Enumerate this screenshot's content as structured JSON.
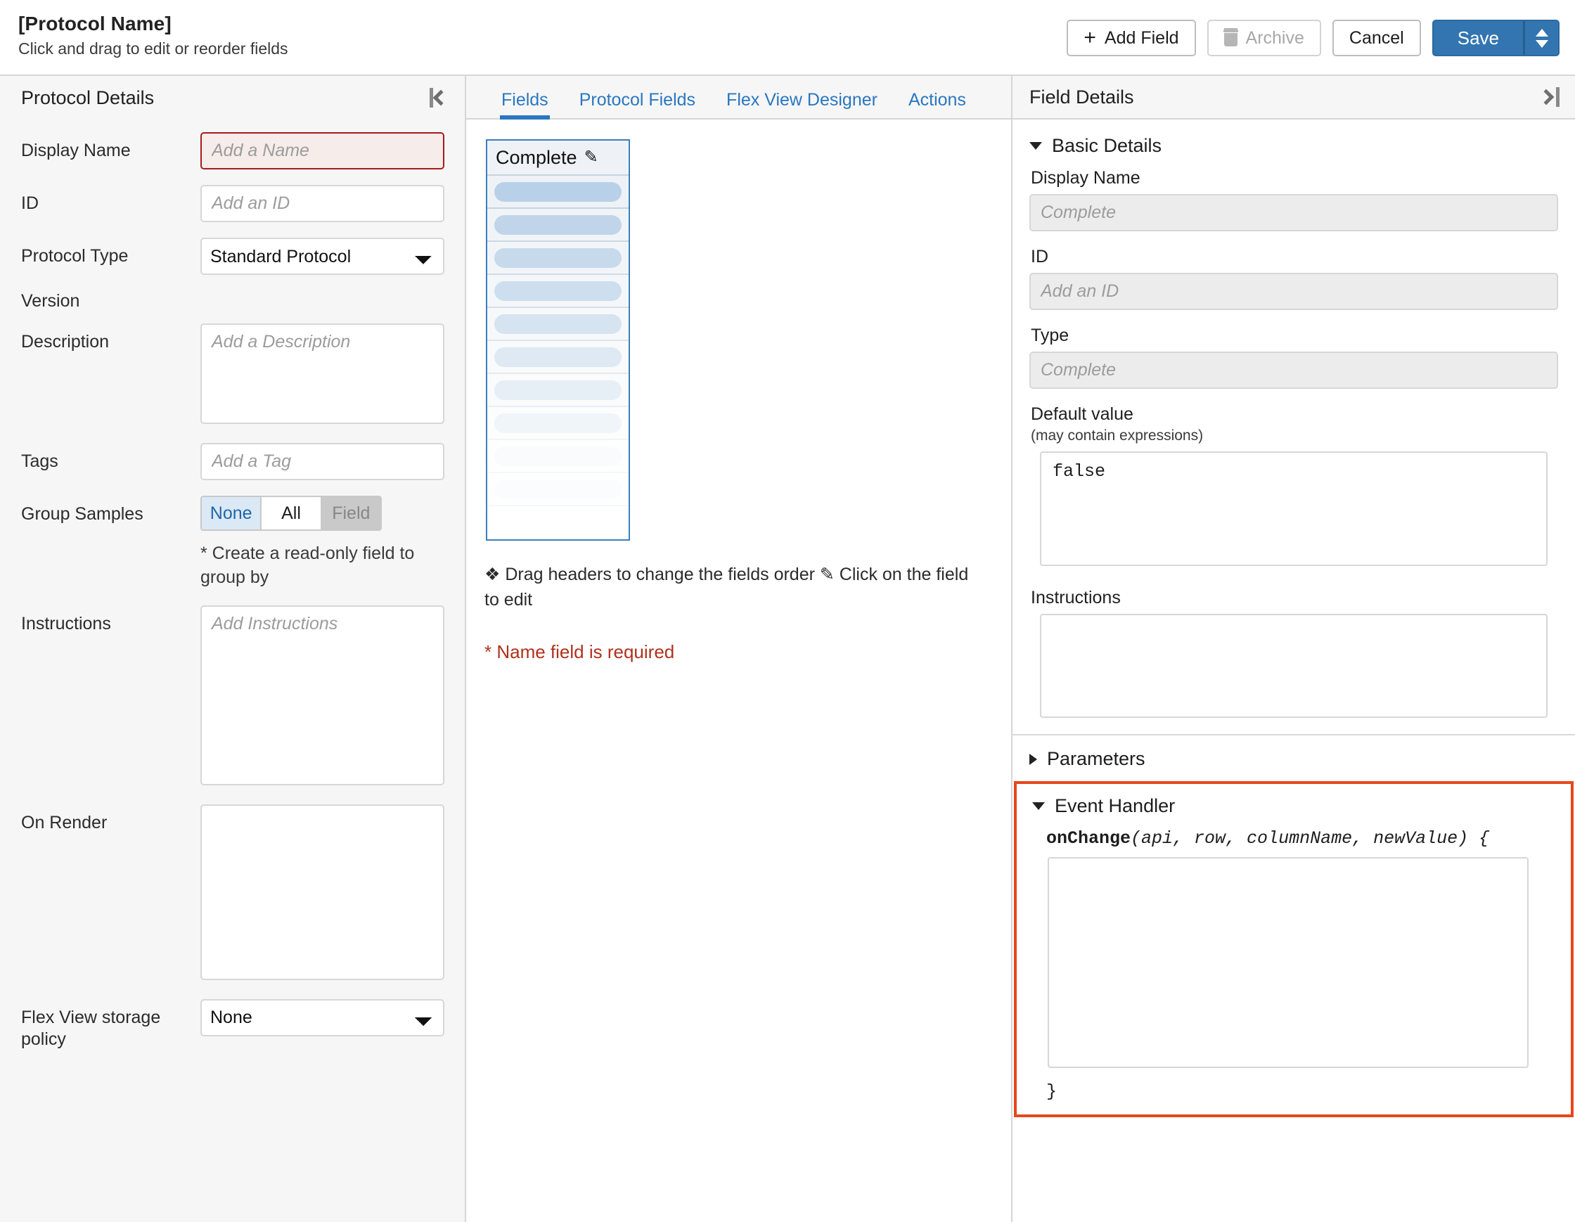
{
  "header": {
    "title": "[Protocol Name]",
    "subtitle": "Click and drag to edit or reorder fields",
    "buttons": {
      "add_field": "Add Field",
      "archive": "Archive",
      "cancel": "Cancel",
      "save": "Save"
    }
  },
  "left_panel": {
    "title": "Protocol Details",
    "fields": {
      "display_name_label": "Display Name",
      "display_name_placeholder": "Add a Name",
      "display_name_value": "",
      "id_label": "ID",
      "id_placeholder": "Add an ID",
      "id_value": "",
      "protocol_type_label": "Protocol Type",
      "protocol_type_value": "Standard Protocol",
      "version_label": "Version",
      "version_value": "",
      "description_label": "Description",
      "description_placeholder": "Add a Description",
      "description_value": "",
      "tags_label": "Tags",
      "tags_placeholder": "Add a Tag",
      "tags_value": "",
      "group_samples_label": "Group Samples",
      "group_samples_options": [
        "None",
        "All",
        "Field"
      ],
      "group_samples_selected": "None",
      "group_samples_disabled": "Field",
      "group_samples_hint": "* Create a read-only field to group by",
      "instructions_label": "Instructions",
      "instructions_placeholder": "Add Instructions",
      "instructions_value": "",
      "on_render_label": "On Render",
      "on_render_value": "",
      "flex_view_label": "Flex View storage policy",
      "flex_view_value": "None"
    }
  },
  "center_panel": {
    "tabs": [
      {
        "label": "Fields",
        "active": true
      },
      {
        "label": "Protocol Fields",
        "active": false
      },
      {
        "label": "Flex View Designer",
        "active": false
      },
      {
        "label": "Actions",
        "active": false
      }
    ],
    "grid": {
      "column_header": "Complete",
      "row_count": 10
    },
    "legend_drag": "Drag headers to change the fields order",
    "legend_edit": "Click on the field to edit",
    "error_message": "* Name field is required"
  },
  "right_panel": {
    "title": "Field Details",
    "basic_details": {
      "section_label": "Basic Details",
      "display_name_label": "Display Name",
      "display_name_value": "Complete",
      "id_label": "ID",
      "id_placeholder": "Add an ID",
      "id_value": "",
      "type_label": "Type",
      "type_value": "Complete",
      "default_value_label": "Default value",
      "default_value_note": "(may contain expressions)",
      "default_value": "false",
      "instructions_label": "Instructions",
      "instructions_value": ""
    },
    "parameters": {
      "section_label": "Parameters",
      "expanded": false
    },
    "event_handler": {
      "section_label": "Event Handler",
      "expanded": true,
      "signature_name": "onChange",
      "signature_args": "(api, row, columnName, newValue) {",
      "body": "",
      "closing_brace": "}"
    }
  },
  "colors": {
    "accent_blue": "#2a77c0",
    "save_blue": "#3275b0",
    "error_red": "#b0311c",
    "highlight_orange": "#e8461d",
    "required_border": "#a61b1b"
  }
}
